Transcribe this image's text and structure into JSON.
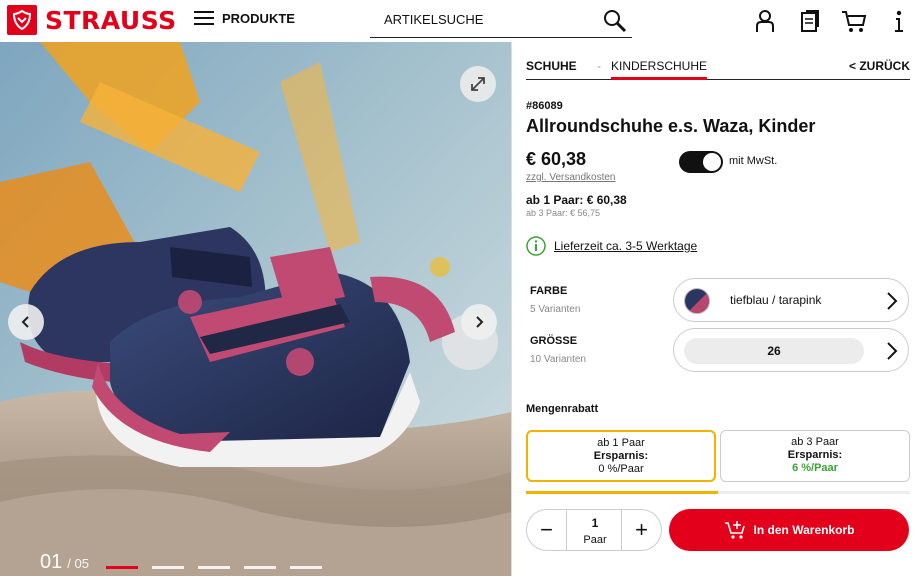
{
  "header": {
    "logo_text": "STRAUSS",
    "menu_label": "PRODUKTE",
    "search_placeholder": "ARTIKELSUCHE",
    "icons": [
      "account-icon",
      "clipboard-icon",
      "cart-icon",
      "info-icon"
    ]
  },
  "gallery": {
    "current": "01",
    "total": "/ 05",
    "slide_count": 5,
    "active_index": 0
  },
  "product": {
    "breadcrumb": [
      "SCHUHE",
      "KINDERSCHUHE"
    ],
    "breadcrumb_sep": "-",
    "back_label": "< ZURÜCK",
    "sku": "#86089",
    "title": "Allroundschuhe e.s. Waza, Kinder",
    "price": "€ 60,38",
    "shipping": "zzgl. Versandkosten",
    "vat_toggle_label": "mit MwSt.",
    "vat_toggle_on": true,
    "tier_main": "ab 1 Paar: € 60,38",
    "tier_sub": "ab 3 Paar: € 56,75",
    "delivery": "Lieferzeit ca. 3-5 Werktage"
  },
  "options": {
    "color_label": "FARBE",
    "color_variants": "5 Varianten",
    "color_value": "tiefblau / tarapink",
    "size_label": "GRÖSSE",
    "size_variants": "10 Varianten",
    "size_value": "26"
  },
  "discount": {
    "title": "Mengenrabatt",
    "tiers": [
      {
        "qty": "ab 1 Paar",
        "label": "Ersparnis:",
        "value": "0 %/Paar"
      },
      {
        "qty": "ab 3 Paar",
        "label": "Ersparnis:",
        "value": "6 %/Paar"
      }
    ],
    "progress": 0.5
  },
  "cart": {
    "quantity": "1",
    "unit": "Paar",
    "minus": "−",
    "plus": "+",
    "button_label": "In den Warenkorb"
  },
  "colors": {
    "brand": "#e2001a",
    "tier_active": "#f0b400",
    "savings_green": "#3aa335"
  }
}
